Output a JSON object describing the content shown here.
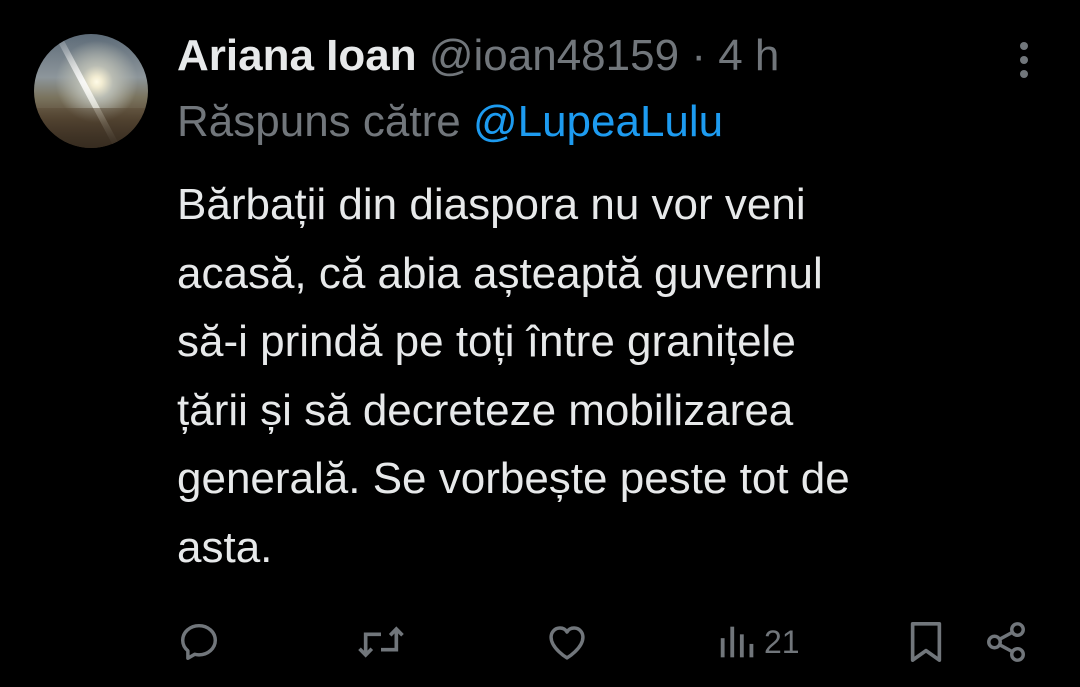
{
  "author": {
    "name": "Ariana Ioan",
    "handle": "@ioan48159",
    "separator": "·",
    "time": "4 h"
  },
  "reply": {
    "prefix": "Răspuns către",
    "mention": "@LupeaLulu"
  },
  "tweet_text": "Bărbații din diaspora nu vor veni\nacasă, că abia așteaptă guvernul\nsă-i prindă pe toți între granițele\nțării și să decreteze mobilizarea\ngenerală. Se vorbește peste tot de\nasta.",
  "actions": {
    "views_count": "21"
  },
  "icons": {
    "more": "more-vertical-icon",
    "reply": "reply-icon",
    "retweet": "retweet-icon",
    "like": "heart-icon",
    "views": "views-icon",
    "bookmark": "bookmark-icon",
    "share": "share-icon"
  },
  "colors": {
    "background": "#000000",
    "text_primary": "#e7e9ea",
    "text_secondary": "#71767b",
    "accent": "#1d9bf0"
  }
}
